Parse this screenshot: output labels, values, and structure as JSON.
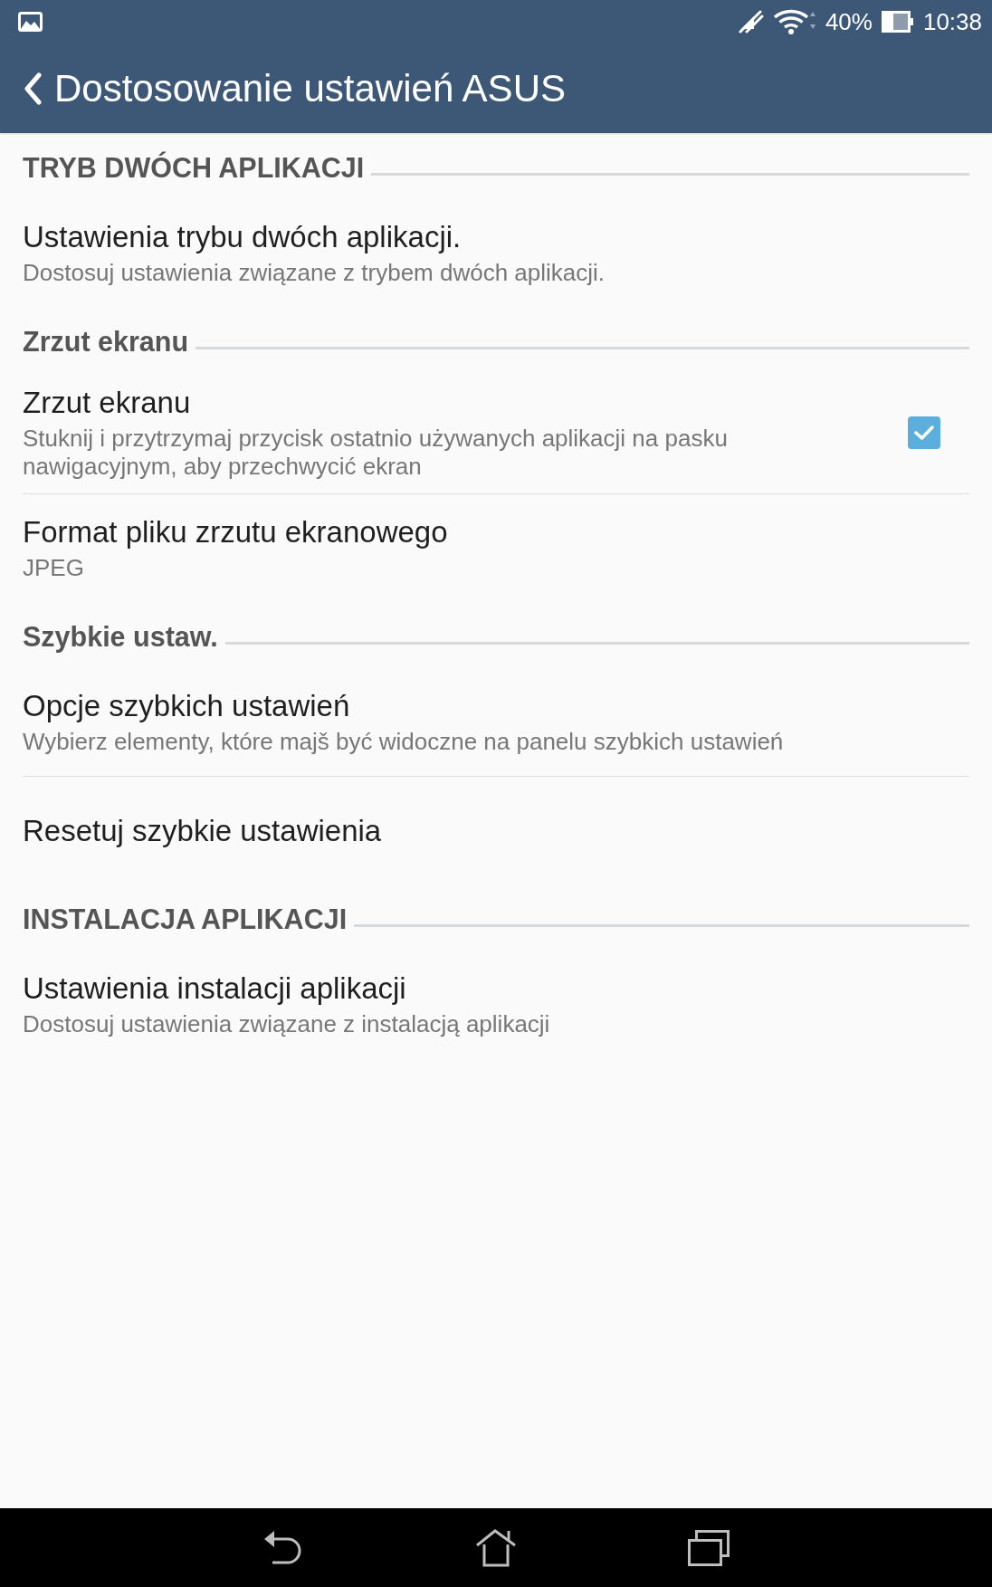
{
  "status_bar": {
    "battery_text": "40%",
    "time": "10:38"
  },
  "app_bar": {
    "title": "Dostosowanie ustawień ASUS"
  },
  "sections": [
    {
      "title": "TRYB DWÓCH APLIKACJI",
      "items": [
        {
          "kind": "text",
          "title": "Ustawienia trybu dwóch aplikacji.",
          "summary": "Dostosuj ustawienia związane z trybem dwóch aplikacji."
        }
      ]
    },
    {
      "title": "Zrzut ekranu",
      "items": [
        {
          "kind": "checkbox",
          "title": "Zrzut ekranu",
          "summary": "Stuknij i przytrzymaj przycisk ostatnio używanych aplikacji na pasku nawigacyjnym, aby przechwycić ekran",
          "checked": true
        },
        {
          "kind": "text",
          "title": "Format pliku zrzutu ekranowego",
          "summary": "JPEG"
        }
      ]
    },
    {
      "title": "Szybkie ustaw.",
      "items": [
        {
          "kind": "text",
          "title": "Opcje szybkich ustawień",
          "summary": "Wybierz elementy, które majš być widoczne na panelu szybkich ustawień"
        },
        {
          "kind": "text",
          "title": "Resetuj szybkie ustawienia"
        }
      ]
    },
    {
      "title": "INSTALACJA APLIKACJI",
      "items": [
        {
          "kind": "text",
          "title": "Ustawienia instalacji aplikacji",
          "summary": "Dostosuj ustawienia związane z instalacją aplikacji"
        }
      ]
    }
  ]
}
